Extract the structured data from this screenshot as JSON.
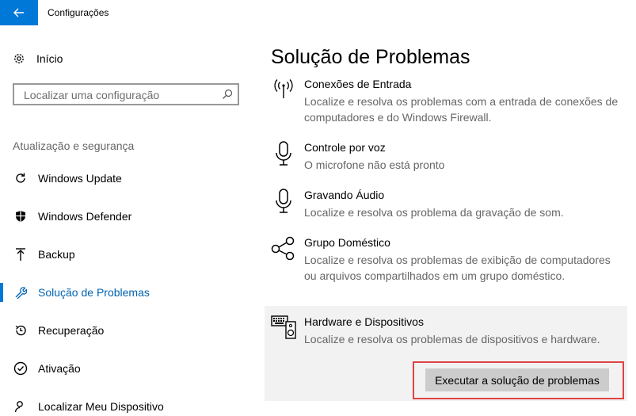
{
  "window": {
    "title": "Configurações"
  },
  "sidebar": {
    "home_label": "Início",
    "search_placeholder": "Localizar uma configuração",
    "section_title": "Atualização e segurança",
    "items": [
      {
        "label": "Windows Update",
        "icon": "refresh-icon"
      },
      {
        "label": "Windows Defender",
        "icon": "shield-icon"
      },
      {
        "label": "Backup",
        "icon": "upload-icon"
      },
      {
        "label": "Solução de Problemas",
        "icon": "wrench-icon",
        "active": true
      },
      {
        "label": "Recuperação",
        "icon": "history-icon"
      },
      {
        "label": "Ativação",
        "icon": "check-circle-icon"
      },
      {
        "label": "Localizar Meu Dispositivo",
        "icon": "person-location-icon"
      }
    ]
  },
  "main": {
    "title": "Solução de Problemas",
    "troubleshooters": [
      {
        "name": "Conexões de Entrada",
        "desc": "Localize e resolva os problemas com a entrada de conexões de computadores e do Windows Firewall.",
        "icon": "antenna-icon"
      },
      {
        "name": "Controle por voz",
        "desc": "O microfone não está pronto",
        "icon": "microphone-icon"
      },
      {
        "name": "Gravando Áudio",
        "desc": "Localize e resolva os problema da gravação de som.",
        "icon": "microphone-icon"
      },
      {
        "name": "Grupo Doméstico",
        "desc": "Localize e resolva os problemas de exibição de computadores ou arquivos compartilhados em um grupo doméstico.",
        "icon": "homegroup-icon"
      },
      {
        "name": "Hardware e Dispositivos",
        "desc": "Localize e resolva os problemas de dispositivos e hardware.",
        "icon": "hardware-icon",
        "selected": true
      }
    ],
    "run_button_label": "Executar a solução de problemas"
  },
  "colors": {
    "accent": "#0078d7",
    "highlight_border": "#e04343",
    "selected_bg": "#f2f2f2"
  }
}
